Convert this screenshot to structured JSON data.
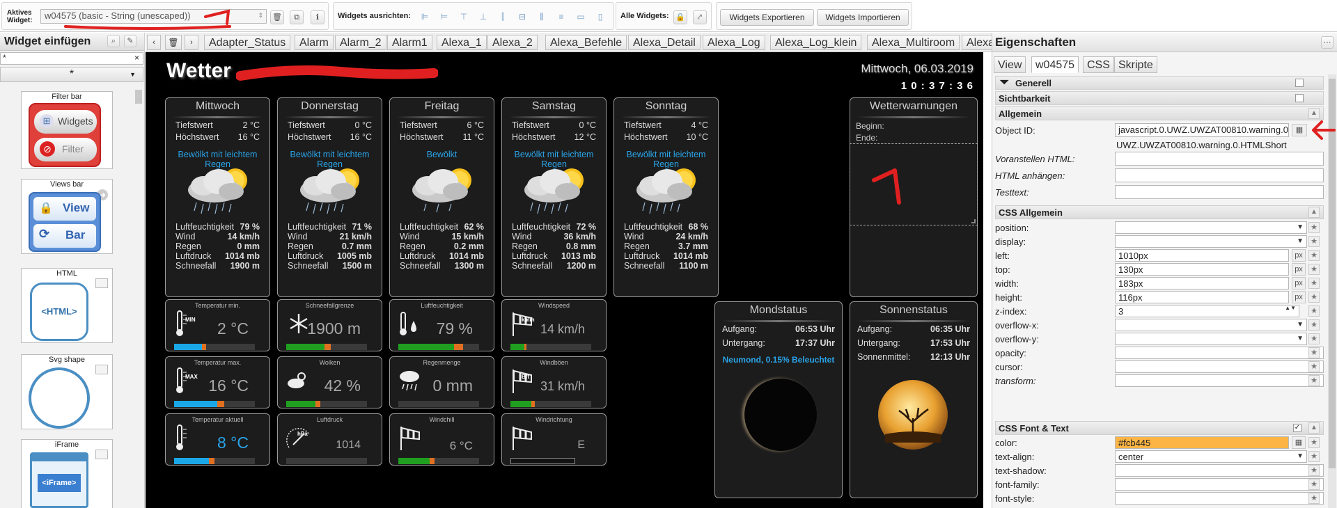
{
  "toolbar": {
    "active_widget_label": "Aktives Widget:",
    "active_widget_value": "w04575 (basic - String (unescaped))",
    "align_label": "Widgets ausrichten:",
    "all_widgets_label": "Alle Widgets:",
    "export_label": "Widgets Exportieren",
    "import_label": "Widgets Importieren"
  },
  "left_panel": {
    "title": "Widget einfügen",
    "filter_value": "*",
    "select_value": "*",
    "cards": [
      {
        "title": "Filter bar",
        "btn1": "Widgets",
        "btn2": "Filter"
      },
      {
        "title": "Views bar",
        "btn1": "View",
        "btn2": "Bar"
      },
      {
        "title": "HTML",
        "inner": "<HTML>"
      },
      {
        "title": "Svg shape"
      },
      {
        "title": "iFrame",
        "inner": "<iFrame>"
      }
    ]
  },
  "view_tabs": [
    "Adapter_Status",
    "Alarm",
    "Alarm_2",
    "Alarm1",
    "Alexa_1",
    "Alexa_2",
    "Alexa_Befehle",
    "Alexa_Detail",
    "Alexa_Log",
    "Alexa_Log_klein",
    "Alexa_Multiroom",
    "Alexa"
  ],
  "dashboard": {
    "title": "Wetter",
    "date": "Mittwoch, 06.03.2019",
    "time": "1 0 : 3 7 : 3 6",
    "labels": {
      "min": "Tiefstwert",
      "max": "Höchstwert",
      "humidity": "Luftfeuchtigkeit",
      "wind": "Wind",
      "rain": "Regen",
      "pressure": "Luftdruck",
      "snow": "Schneefall"
    },
    "days": [
      {
        "name": "Mittwoch",
        "min": "2 °C",
        "max": "16 °C",
        "desc": "Bewölkt mit leichtem Regen",
        "humidity": "79 %",
        "wind": "14 km/h",
        "rain": "0 mm",
        "pressure": "1014 mb",
        "snow": "1900 m"
      },
      {
        "name": "Donnerstag",
        "min": "0 °C",
        "max": "16 °C",
        "desc": "Bewölkt mit leichtem Regen",
        "humidity": "71 %",
        "wind": "21 km/h",
        "rain": "0.7 mm",
        "pressure": "1005 mb",
        "snow": "1500 m"
      },
      {
        "name": "Freitag",
        "min": "6 °C",
        "max": "11 °C",
        "desc": "Bewölkt",
        "humidity": "62 %",
        "wind": "15 km/h",
        "rain": "0.2 mm",
        "pressure": "1014 mb",
        "snow": "1300 m"
      },
      {
        "name": "Samstag",
        "min": "0 °C",
        "max": "12 °C",
        "desc": "Bewölkt mit leichtem Regen",
        "humidity": "72 %",
        "wind": "36 km/h",
        "rain": "0.8 mm",
        "pressure": "1013 mb",
        "snow": "1200 m"
      },
      {
        "name": "Sonntag",
        "min": "4 °C",
        "max": "10 °C",
        "desc": "Bewölkt mit leichtem Regen",
        "humidity": "68 %",
        "wind": "24 km/h",
        "rain": "3.7 mm",
        "pressure": "1014 mb",
        "snow": "1100 m"
      }
    ],
    "warnings": {
      "title": "Wetterwarnungen",
      "begin": "Beginn:",
      "end": "Ende:"
    },
    "small_widgets": [
      {
        "title": "Temperatur min.",
        "value": "2 °C",
        "icon": "thermometer-min-icon",
        "icon_text": "MIN",
        "fill": 0.4,
        "colors": [
          "#1aa7e8",
          "#e07020"
        ]
      },
      {
        "title": "Schneefallgrenze",
        "value": "1900 m",
        "icon": "snowflake-icon",
        "icon_text": "",
        "fill": 0.55,
        "colors": [
          "#1f9e1f",
          "#e07020"
        ]
      },
      {
        "title": "Luftfeuchtigkeit",
        "value": "79 %",
        "icon": "humidity-icon",
        "icon_text": "",
        "fill": 0.8,
        "colors": [
          "#1f9e1f",
          "#e07020"
        ]
      },
      {
        "title": "Windspeed",
        "value": "14 km/h",
        "icon": "windsock-icon",
        "icon_text": "km/h",
        "fill": 0.2,
        "colors": [
          "#1f9e1f",
          "#e07020"
        ]
      },
      {
        "title": "Temperatur max.",
        "value": "16 °C",
        "icon": "thermometer-max-icon",
        "icon_text": "MAX",
        "fill": 0.62,
        "colors": [
          "#1aa7e8",
          "#e07020"
        ]
      },
      {
        "title": "Wolken",
        "value": "42 %",
        "icon": "cloud-sun-icon",
        "icon_text": "",
        "fill": 0.42,
        "colors": [
          "#1f9e1f",
          "#e07020"
        ]
      },
      {
        "title": "Regenmenge",
        "value": "0 mm",
        "icon": "rain-cloud-icon",
        "icon_text": "",
        "fill": 0.0,
        "colors": [
          "#1f9e1f",
          "#e07020"
        ]
      },
      {
        "title": "Windböen",
        "value": "31 km/h",
        "icon": "windsock-bft-icon",
        "icon_text": "Bft",
        "fill": 0.3,
        "colors": [
          "#1f9e1f",
          "#e07020"
        ]
      },
      {
        "title": "Temperatur aktuell",
        "value": "8 °C",
        "icon": "thermometer-icon",
        "icon_text": "",
        "fill": 0.5,
        "colors": [
          "#1aa7e8",
          "#e07020"
        ]
      },
      {
        "title": "Luftdruck",
        "value": "1014",
        "icon": "barometer-icon",
        "icon_text": "hPa",
        "fill": 0.0,
        "colors": [
          "#1f9e1f",
          "#e07020"
        ]
      },
      {
        "title": "Windchill",
        "value": "6 °C",
        "icon": "windchill-icon",
        "icon_text": "",
        "fill": 0.45,
        "colors": [
          "#1f9e1f",
          "#e07020"
        ]
      },
      {
        "title": "Windrichtung",
        "value": "E",
        "icon": "wind-direction-icon",
        "icon_text": "",
        "fill": 0.0,
        "colors": [
          "#1f9e1f",
          "#e07020"
        ]
      }
    ],
    "moon": {
      "title": "Mondstatus",
      "rise_label": "Aufgang:",
      "rise": "06:53 Uhr",
      "set_label": "Untergang:",
      "set": "17:37 Uhr",
      "phase": "Neumond, 0.15% Beleuchtet"
    },
    "sun": {
      "title": "Sonnenstatus",
      "rise_label": "Aufgang:",
      "rise": "06:35 Uhr",
      "set_label": "Untergang:",
      "set": "17:53 Uhr",
      "noon_label": "Sonnenmittel:",
      "noon": "12:13 Uhr"
    }
  },
  "properties": {
    "title": "Eigenschaften",
    "tabs": [
      "View",
      "w04575",
      "CSS",
      "Skripte"
    ],
    "sections": {
      "generell": "Generell",
      "sichtbarkeit": "Sichtbarkeit",
      "allgemein": "Allgemein",
      "css_allgemein": "CSS Allgemein",
      "css_font": "CSS Font & Text"
    },
    "object_id_label": "Object ID:",
    "object_id_value": "javascript.0.UWZ.UWZAT00810.warning.0.HTMLShort",
    "object_id_hint": "UWZ.UWZAT00810.warning.0.HTMLShort",
    "prepend_label": "Voranstellen HTML:",
    "append_label": "HTML anhängen:",
    "testtext_label": "Testtext:",
    "css": [
      {
        "label": "position:",
        "value": "",
        "type": "select"
      },
      {
        "label": "display:",
        "value": "",
        "type": "select"
      },
      {
        "label": "left:",
        "value": "1010px",
        "type": "px"
      },
      {
        "label": "top:",
        "value": "130px",
        "type": "px"
      },
      {
        "label": "width:",
        "value": "183px",
        "type": "px"
      },
      {
        "label": "height:",
        "value": "116px",
        "type": "px"
      },
      {
        "label": "z-index:",
        "value": "3",
        "type": "spin"
      },
      {
        "label": "overflow-x:",
        "value": "",
        "type": "select"
      },
      {
        "label": "overflow-y:",
        "value": "",
        "type": "select"
      },
      {
        "label": "opacity:",
        "value": "",
        "type": "text"
      },
      {
        "label": "cursor:",
        "value": "",
        "type": "text"
      },
      {
        "label": "transform:",
        "value": "",
        "type": "text"
      }
    ],
    "font": [
      {
        "label": "color:",
        "value": "#fcb445",
        "type": "color"
      },
      {
        "label": "text-align:",
        "value": "center",
        "type": "select"
      },
      {
        "label": "text-shadow:",
        "value": "",
        "type": "text"
      },
      {
        "label": "font-family:",
        "value": "",
        "type": "text"
      },
      {
        "label": "font-style:",
        "value": "",
        "type": "text"
      }
    ],
    "px_label": "px"
  },
  "colors": {
    "accent_blue": "#2aa4e8",
    "highlight_orange": "#fcb445",
    "annotation_red": "#e02020"
  }
}
